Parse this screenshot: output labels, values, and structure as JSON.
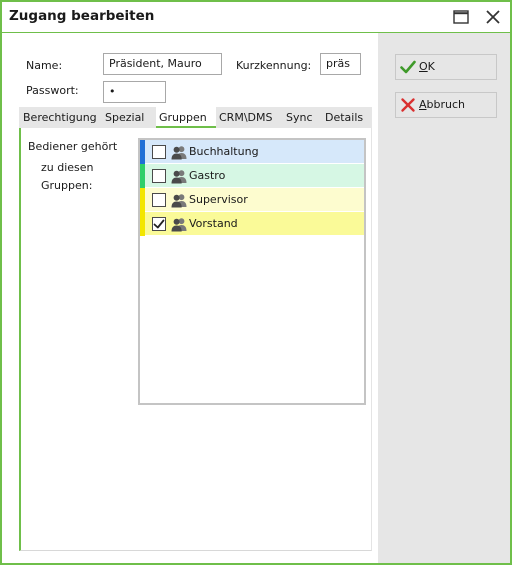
{
  "window": {
    "title": "Zugang bearbeiten"
  },
  "icons": {
    "maximize": "maximize-icon",
    "close": "close-icon",
    "group": "group-icon",
    "ok": "check-icon",
    "cancel": "x-icon"
  },
  "form": {
    "name_label": "Name:",
    "name_value": "Präsident, Mauro",
    "code_label": "Kurzkennung:",
    "code_value": "präs",
    "password_label": "Passwort:",
    "password_value": "•"
  },
  "tabs": [
    {
      "label": "Berechtigung"
    },
    {
      "label": "Spezial"
    },
    {
      "label": "Gruppen"
    },
    {
      "label": "CRM\\DMS"
    },
    {
      "label": "Sync"
    },
    {
      "label": "Details"
    }
  ],
  "active_tab": "Gruppen",
  "groups_panel": {
    "caption_line1": "Bediener gehört",
    "caption_line2": "zu diesen",
    "caption_line3": "Gruppen:",
    "groups": [
      {
        "name": "Buchhaltung",
        "checked": false,
        "accent": "#1f6fd6",
        "bg": "#d6e8fa"
      },
      {
        "name": "Gastro",
        "checked": false,
        "accent": "#2ecf6a",
        "bg": "#d6f7e4"
      },
      {
        "name": "Supervisor",
        "checked": false,
        "accent": "#f3e600",
        "bg": "#fdfccf"
      },
      {
        "name": "Vorstand",
        "checked": true,
        "accent": "#f3e600",
        "bg": "#fafa98"
      }
    ]
  },
  "buttons": {
    "ok_label": "OK",
    "cancel_label": "Abbruch"
  },
  "colors": {
    "accent_green": "#6fbf4a",
    "ok_green": "#3f9a2a",
    "cancel_red": "#d93030"
  }
}
